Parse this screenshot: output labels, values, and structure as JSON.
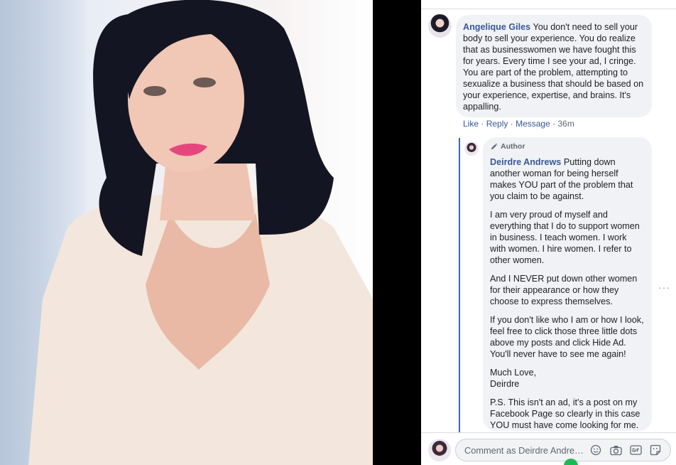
{
  "comments": [
    {
      "name": "Angelique Giles",
      "text": "You don't need to sell your body to sell your experience. You do realize that as businesswomen we have fought this for years. Every time I see your ad, I cringe. You are part of the problem, attempting to sexualize a business that should be based on your experience, expertise, and brains. It's appalling.",
      "actions": {
        "like": "Like",
        "reply": "Reply",
        "message": "Message",
        "sep": "·",
        "time": "36m"
      }
    }
  ],
  "reply": {
    "tag": "Author",
    "name": "Deirdre Andrews",
    "p1": "Putting down another woman for being herself makes YOU part of the problem that you claim to be against.",
    "p2": "I am very proud of myself and everything that I do to support women in business. I teach women. I work with women. I hire women. I refer to other women.",
    "p3": "And I NEVER put down other women for their appearance or how they choose to express themselves.",
    "p4": "If you don't like who I am or how I look, feel free to click those three little dots above my posts and click Hide Ad. You'll never have to see me again!",
    "p5a": "Much Love,",
    "p5b": "Deirdre",
    "p6": "P.S. This isn't an ad, it's a post on my Facebook Page so clearly in this case YOU must have come looking for me."
  },
  "composer": {
    "placeholder": "Comment as Deirdre Andre…"
  },
  "more": "···",
  "colors": {
    "link": "#385898",
    "bubble": "#f0f2f5",
    "reply_rule": "#4267b2"
  },
  "icons": [
    "pencil-icon",
    "emoji-icon",
    "camera-icon",
    "gif-icon",
    "sticker-icon",
    "more-options-icon"
  ]
}
